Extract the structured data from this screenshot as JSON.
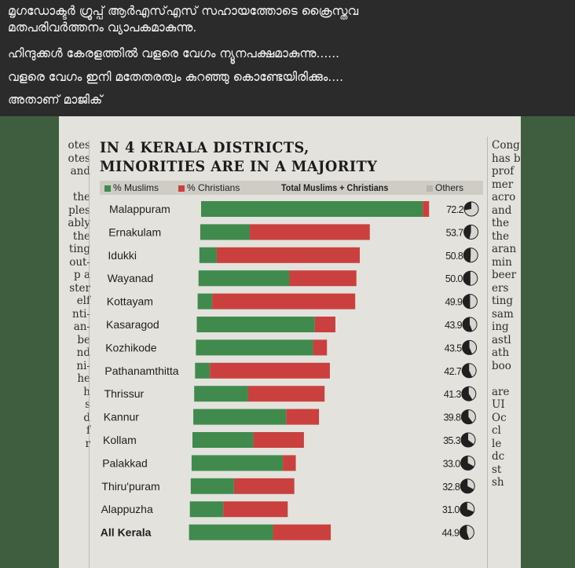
{
  "post": {
    "lines": [
      "മൃഗഡോക്ടർ ഗ്രൂപ്പ് ആർഎസ്എസ് സഹായത്തോടെ ക്രൈസ്തവ",
      "മതപരിവർത്തനം വ്യാപകമാകുന്നു.",
      "ഹിന്ദുക്കൾ കേരളത്തിൽ വളരെ വേഗം ന്യൂനപക്ഷമാകുന്നു......",
      "വളരെ വേഗം ഇനി മതേതരത്വം കുറഞ്ഞു കൊണ്ടേയിരിക്കും....",
      "അതാണ് മാജിക്"
    ]
  },
  "newspaper": {
    "left_column": [
      "otes",
      "otes",
      "and",
      "",
      "the",
      "ples",
      "ably",
      "the",
      "ting",
      "out-",
      "p a",
      "ster",
      "elf",
      "nti-",
      "an-",
      "be",
      "nd",
      "ni-",
      "he",
      "h",
      "s",
      "d",
      "f",
      "r"
    ],
    "right_column": [
      "Cong",
      "has b",
      "prof",
      "mer",
      "acro",
      "and",
      "the",
      "the",
      "aran",
      "min",
      "beer",
      "ers",
      "ting",
      "sam",
      "ing",
      "astl",
      "ath",
      "boo",
      "",
      "are",
      "UI",
      "Oc",
      "cl",
      "le",
      "dc",
      "st",
      "sh"
    ]
  },
  "chart_data": {
    "type": "bar",
    "title": [
      "IN 4 KERALA DISTRICTS,",
      "MINORITIES ARE IN A MAJORITY"
    ],
    "legend": {
      "muslims": "% Muslims",
      "christians": "% Christians",
      "total": "Total Muslims + Christians",
      "others": "Others"
    },
    "colors": {
      "muslims": "#3f8a4c",
      "christians": "#c9403f",
      "others_light": "#d9d6cf",
      "others_dark": "#202020"
    },
    "categories": [
      "Malappuram",
      "Ernakulam",
      "Idukki",
      "Wayanad",
      "Kottayam",
      "Kasaragod",
      "Kozhikode",
      "Pathanamthitta",
      "Thrissur",
      "Kannur",
      "Kollam",
      "Palakkad",
      "Thiru'puram",
      "Alappuzha",
      "All Kerala"
    ],
    "series": [
      {
        "name": "% Muslims",
        "values": [
          70.2,
          15.7,
          5.5,
          28.8,
          4.6,
          37.4,
          37.1,
          4.7,
          17.1,
          29.4,
          19.3,
          28.9,
          13.7,
          10.6,
          26.6
        ]
      },
      {
        "name": "% Christians",
        "values": [
          2.0,
          38.0,
          45.3,
          21.2,
          45.3,
          6.5,
          4.4,
          38.0,
          24.2,
          10.4,
          16.0,
          4.1,
          19.1,
          20.4,
          18.3
        ]
      }
    ],
    "totals": [
      "72.2",
      "53.7",
      "50.8",
      "50.0",
      "49.9",
      "43.9",
      "43.5",
      "42.7",
      "41.3",
      "39.8",
      "35.3",
      "33.0",
      "32.8",
      "31.0",
      "44.9"
    ],
    "total_values": [
      72.2,
      53.7,
      50.8,
      50.0,
      49.9,
      43.9,
      43.5,
      42.7,
      41.3,
      39.8,
      35.3,
      33.0,
      32.8,
      31.0,
      44.9
    ]
  }
}
